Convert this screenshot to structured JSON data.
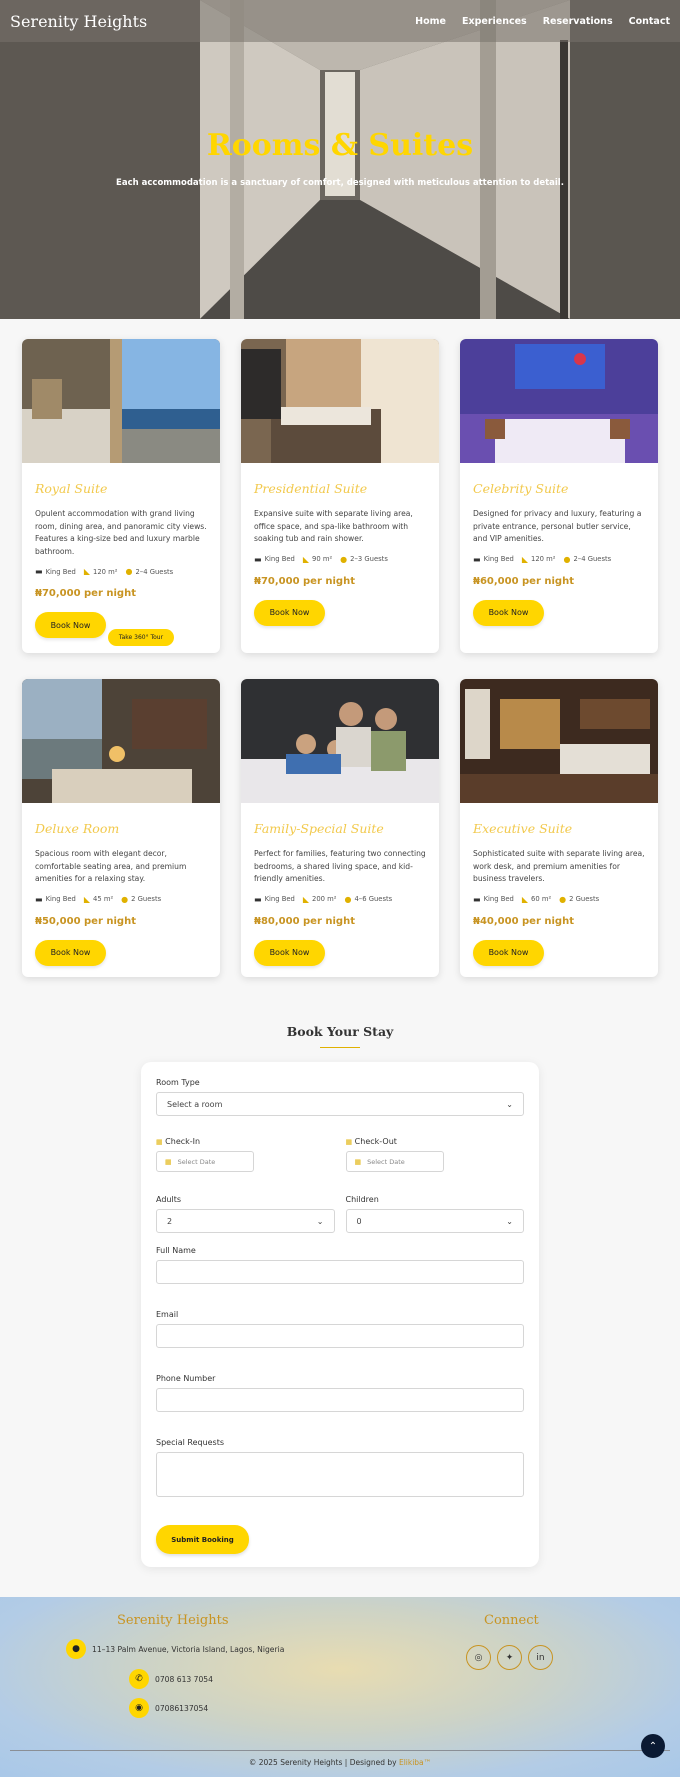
{
  "nav": {
    "brand": "Serenity Heights",
    "links": [
      "Home",
      "Experiences",
      "Reservations",
      "Contact"
    ]
  },
  "hero": {
    "title": "Rooms & Suites",
    "subtitle": "Each accommodation is a sanctuary of comfort, designed with meticulous attention to detail."
  },
  "rooms": [
    {
      "title": "Royal Suite",
      "description": "Opulent accommodation with grand living room, dining area, and panoramic city views. Features a king-size bed and luxury marble bathroom.",
      "bed": "King Bed",
      "size": "120 m²",
      "guests": "2–4 Guests",
      "price": "₦70,000 per night",
      "book_label": "Book Now",
      "tour_label": "Take 360° Tour"
    },
    {
      "title": "Presidential Suite",
      "description": "Expansive suite with separate living area, office space, and spa-like bathroom with soaking tub and rain shower.",
      "bed": "King Bed",
      "size": "90 m²",
      "guests": "2–3 Guests",
      "price": "₦70,000 per night",
      "book_label": "Book Now"
    },
    {
      "title": "Celebrity Suite",
      "description": "Designed for privacy and luxury, featuring a private entrance, personal butler service, and VIP amenities.",
      "bed": "King Bed",
      "size": "120 m²",
      "guests": "2–4 Guests",
      "price": "₦60,000 per night",
      "book_label": "Book Now"
    },
    {
      "title": "Deluxe Room",
      "description": "Spacious room with elegant decor, comfortable seating area, and premium amenities for a relaxing stay.",
      "bed": "King Bed",
      "size": "45 m²",
      "guests": "2 Guests",
      "price": "₦50,000 per night",
      "book_label": "Book Now"
    },
    {
      "title": "Family-Special Suite",
      "description": "Perfect for families, featuring two connecting bedrooms, a shared living space, and kid-friendly amenities.",
      "bed": "King Bed",
      "size": "200 m²",
      "guests": "4–6 Guests",
      "price": "₦80,000 per night",
      "book_label": "Book Now"
    },
    {
      "title": "Executive Suite",
      "description": "Sophisticated suite with separate living area, work desk, and premium amenities for business travelers.",
      "bed": "King Bed",
      "size": "60 m²",
      "guests": "2 Guests",
      "price": "₦40,000 per night",
      "book_label": "Book Now"
    }
  ],
  "booking": {
    "heading": "Book Your Stay",
    "room_type_label": "Room Type",
    "room_type_value": "Select a room",
    "checkin_label": "Check-In",
    "checkout_label": "Check-Out",
    "date_placeholder": "Select Date",
    "adults_label": "Adults",
    "adults_value": "2",
    "children_label": "Children",
    "children_value": "0",
    "fullname_label": "Full Name",
    "email_label": "Email",
    "phone_label": "Phone Number",
    "requests_label": "Special Requests",
    "submit_label": "Submit Booking"
  },
  "footer": {
    "brand": "Serenity Heights",
    "address": "11–13 Palm Avenue, Victoria Island, Lagos, Nigeria",
    "phone": "0708 613 7054",
    "whatsapp": "07086137054",
    "connect": "Connect",
    "social_icons": [
      "instagram-icon",
      "twitter-icon",
      "linkedin-icon"
    ],
    "copyright": "© 2025 Serenity Heights | Designed by",
    "designer": "Elikiba™"
  },
  "colors": {
    "accent": "#ffd600",
    "gold_text": "#c89422",
    "title_gold": "#f2c94c"
  }
}
